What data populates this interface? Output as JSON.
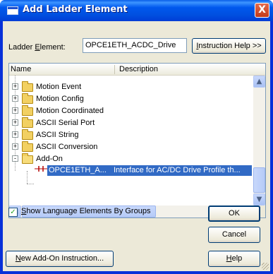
{
  "window": {
    "title": "Add Ladder Element",
    "close_glyph": "X"
  },
  "ladder_element": {
    "label_prefix": "Ladder ",
    "label_accel": "E",
    "label_suffix": "lement:",
    "value": "OPCE1ETH_ACDC_Drive"
  },
  "buttons": {
    "instruction_help_accel": "I",
    "instruction_help_rest": "nstruction Help >>",
    "ok": "OK",
    "cancel": "Cancel",
    "help_accel": "H",
    "help_rest": "elp",
    "new_addon_accel": "N",
    "new_addon_rest": "ew Add-On Instruction..."
  },
  "tree": {
    "columns": [
      "Name",
      "Description"
    ],
    "items": [
      {
        "label": "Motion Event",
        "expander": "+"
      },
      {
        "label": "Motion Config",
        "expander": "+"
      },
      {
        "label": "Motion Coordinated",
        "expander": "+"
      },
      {
        "label": "ASCII Serial Port",
        "expander": "+"
      },
      {
        "label": "ASCII String",
        "expander": "+"
      },
      {
        "label": "ASCII Conversion",
        "expander": "+"
      },
      {
        "label": "Add-On",
        "expander": "-"
      }
    ],
    "selected": {
      "name": "OPCE1ETH_A...",
      "description": "Interface for AC/DC Drive Profile th..."
    }
  },
  "checkbox": {
    "checked": true,
    "check_glyph": "✓",
    "label_accel": "S",
    "label_rest": "how Language Elements By Groups"
  },
  "colors": {
    "title_bar": "#0054e3",
    "selection": "#316ac5",
    "dialog_bg": "#ece9d8"
  },
  "icons": [
    "window-icon",
    "close-icon",
    "folder-icon",
    "ladder-instruction-icon",
    "scroll-up-icon",
    "scroll-down-icon",
    "scroll-left-icon",
    "scroll-right-icon"
  ]
}
